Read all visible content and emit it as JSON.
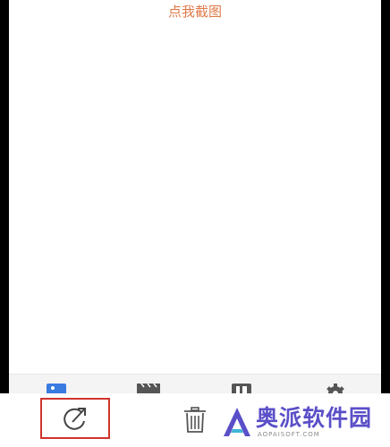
{
  "header": {
    "capture_label": "点我截图"
  },
  "tabbar": {
    "tabs": [
      {
        "name": "photos",
        "icon": "photo-icon",
        "color": "#3a7be0"
      },
      {
        "name": "video",
        "icon": "clapperboard-icon",
        "color": "#555555"
      },
      {
        "name": "hd",
        "icon": "hd-icon",
        "color": "#555555"
      },
      {
        "name": "settings",
        "icon": "gear-icon",
        "color": "#555555"
      }
    ]
  },
  "bottombar": {
    "share_icon": "share-icon",
    "delete_icon": "trash-icon",
    "highlight_color": "#d0342c"
  },
  "watermark": {
    "name": "奥派软件园",
    "url": "AOPAISOFT.COM",
    "color": "#5a4fc8"
  }
}
